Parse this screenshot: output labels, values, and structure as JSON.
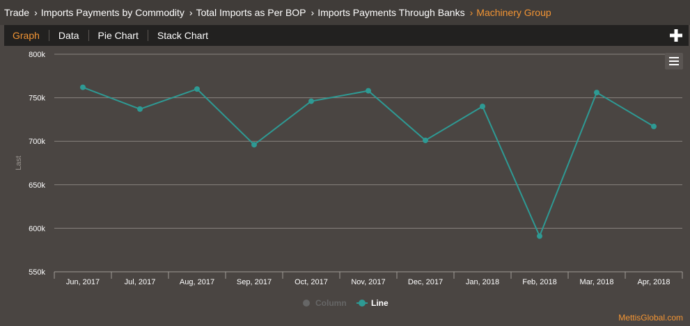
{
  "breadcrumb": {
    "items": [
      {
        "label": "Trade",
        "active": false
      },
      {
        "label": "Imports Payments by Commodity",
        "active": false
      },
      {
        "label": "Total Imports as Per BOP",
        "active": false
      },
      {
        "label": "Imports Payments Through Banks",
        "active": false
      },
      {
        "label": "Machinery Group",
        "active": true
      }
    ]
  },
  "tabs": [
    {
      "label": "Graph",
      "active": true
    },
    {
      "label": "Data",
      "active": false
    },
    {
      "label": "Pie Chart",
      "active": false
    },
    {
      "label": "Stack Chart",
      "active": false
    }
  ],
  "icons": {
    "plus": "plus-icon",
    "menu": "hamburger-menu-icon"
  },
  "colors": {
    "accent": "#f39534",
    "line": "#2e9a94",
    "background": "#4a4542",
    "legend_inactive": "#666666"
  },
  "watermark": "MettisGlobal.com",
  "chart_data": {
    "type": "line",
    "title": "",
    "xlabel": "",
    "ylabel": "Last",
    "categories": [
      "Jun, 2017",
      "Jul, 2017",
      "Aug, 2017",
      "Sep, 2017",
      "Oct, 2017",
      "Nov, 2017",
      "Dec, 2017",
      "Jan, 2018",
      "Feb, 2018",
      "Mar, 2018",
      "Apr, 2018"
    ],
    "series": [
      {
        "name": "Column",
        "visible": false,
        "values": []
      },
      {
        "name": "Line",
        "visible": true,
        "values": [
          762000,
          737000,
          760000,
          696000,
          746000,
          758000,
          701000,
          740000,
          591000,
          756000,
          717000
        ]
      }
    ],
    "ylim": [
      550000,
      800000
    ],
    "yticks": [
      "550k",
      "600k",
      "650k",
      "700k",
      "750k",
      "800k"
    ],
    "ytick_values": [
      550000,
      600000,
      650000,
      700000,
      750000,
      800000
    ],
    "grid": true,
    "legend_position": "bottom-center"
  }
}
